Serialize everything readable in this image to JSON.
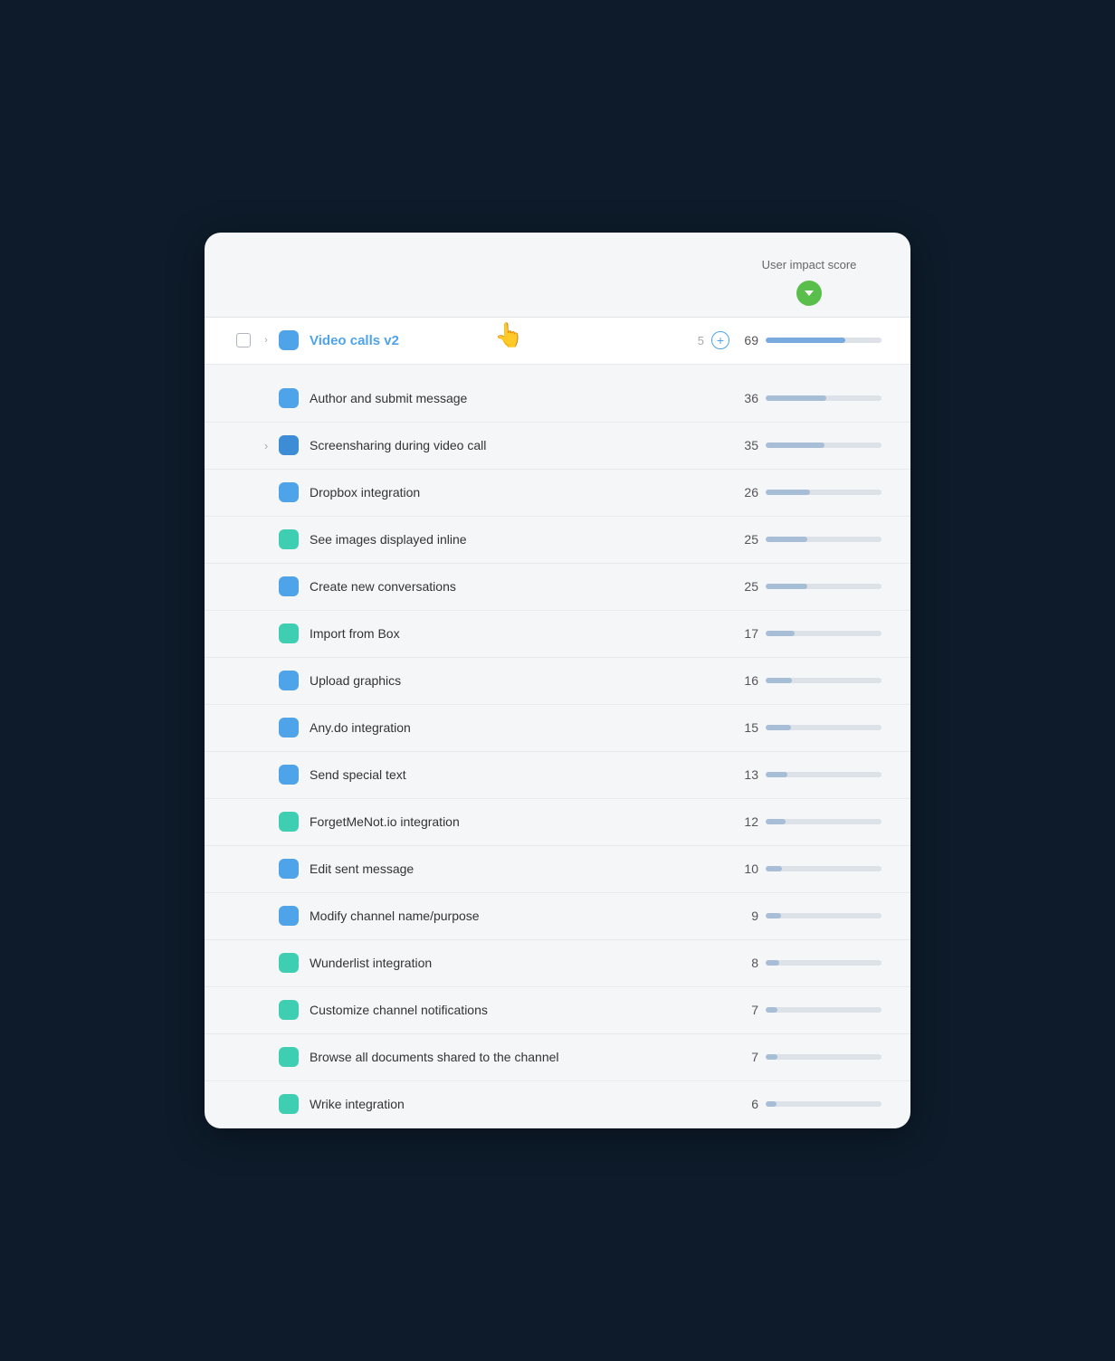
{
  "header": {
    "score_label": "User impact score",
    "sort_direction": "descending"
  },
  "parent_feature": {
    "name": "Video calls v2",
    "child_count": "5",
    "score": 69,
    "score_pct": 69,
    "icon_color": "icon-blue",
    "is_link": true,
    "has_chevron": true,
    "has_checkbox": true
  },
  "features": [
    {
      "name": "Author and submit message",
      "score": 36,
      "score_pct": 52,
      "icon_color": "icon-blue",
      "has_chevron": false
    },
    {
      "name": "Screensharing during video call",
      "score": 35,
      "score_pct": 51,
      "icon_color": "icon-blue-dark",
      "has_chevron": true
    },
    {
      "name": "Dropbox integration",
      "score": 26,
      "score_pct": 38,
      "icon_color": "icon-blue",
      "has_chevron": false
    },
    {
      "name": "See images displayed inline",
      "score": 25,
      "score_pct": 36,
      "icon_color": "icon-teal",
      "has_chevron": false
    },
    {
      "name": "Create new conversations",
      "score": 25,
      "score_pct": 36,
      "icon_color": "icon-blue",
      "has_chevron": false
    },
    {
      "name": "Import from Box",
      "score": 17,
      "score_pct": 25,
      "icon_color": "icon-teal",
      "has_chevron": false
    },
    {
      "name": "Upload graphics",
      "score": 16,
      "score_pct": 23,
      "icon_color": "icon-blue",
      "has_chevron": false
    },
    {
      "name": "Any.do integration",
      "score": 15,
      "score_pct": 22,
      "icon_color": "icon-blue",
      "has_chevron": false
    },
    {
      "name": "Send special text",
      "score": 13,
      "score_pct": 19,
      "icon_color": "icon-blue",
      "has_chevron": false
    },
    {
      "name": "ForgetMeNot.io integration",
      "score": 12,
      "score_pct": 17,
      "icon_color": "icon-teal",
      "has_chevron": false
    },
    {
      "name": "Edit sent message",
      "score": 10,
      "score_pct": 14,
      "icon_color": "icon-blue",
      "has_chevron": false
    },
    {
      "name": "Modify channel name/purpose",
      "score": 9,
      "score_pct": 13,
      "icon_color": "icon-blue",
      "has_chevron": false
    },
    {
      "name": "Wunderlist integration",
      "score": 8,
      "score_pct": 12,
      "icon_color": "icon-teal",
      "has_chevron": false
    },
    {
      "name": "Customize channel notifications",
      "score": 7,
      "score_pct": 10,
      "icon_color": "icon-teal",
      "has_chevron": false
    },
    {
      "name": "Browse all documents shared to the channel",
      "score": 7,
      "score_pct": 10,
      "icon_color": "icon-teal",
      "has_chevron": false
    },
    {
      "name": "Wrike integration",
      "score": 6,
      "score_pct": 9,
      "icon_color": "icon-teal",
      "has_chevron": false
    }
  ],
  "labels": {
    "add_btn": "+",
    "chevron_right": "›",
    "checkbox_label": "Select feature"
  }
}
